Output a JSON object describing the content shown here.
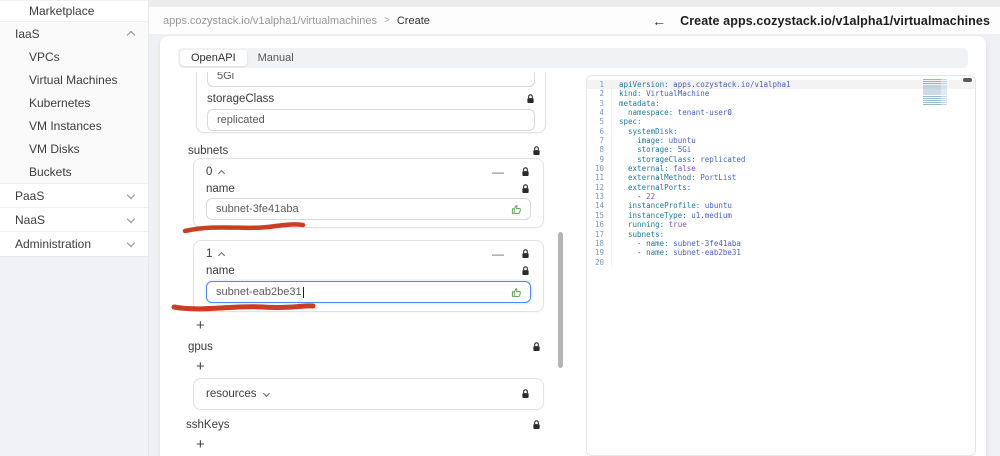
{
  "sidebar": {
    "items": [
      {
        "label": "Marketplace",
        "kind": "child",
        "divider": true,
        "group_bg": false
      },
      {
        "label": "IaaS",
        "kind": "group",
        "chevron": "up",
        "divider": true,
        "group_bg": true
      },
      {
        "label": "VPCs",
        "kind": "child",
        "divider": false,
        "group_bg": true
      },
      {
        "label": "Virtual Machines",
        "kind": "child",
        "divider": false,
        "group_bg": true
      },
      {
        "label": "Kubernetes",
        "kind": "child",
        "divider": false,
        "group_bg": true
      },
      {
        "label": "VM Instances",
        "kind": "child",
        "divider": false,
        "group_bg": true
      },
      {
        "label": "VM Disks",
        "kind": "child",
        "divider": false,
        "group_bg": true
      },
      {
        "label": "Buckets",
        "kind": "child",
        "divider": false,
        "group_bg": true
      },
      {
        "label": "PaaS",
        "kind": "group",
        "chevron": "down",
        "divider": true,
        "group_bg": false
      },
      {
        "label": "NaaS",
        "kind": "group",
        "chevron": "down",
        "divider": true,
        "group_bg": false
      },
      {
        "label": "Administration",
        "kind": "group",
        "chevron": "down",
        "divider": true,
        "group_bg": false
      }
    ]
  },
  "breadcrumb": {
    "path": "apps.cozystack.io/v1alpha1/virtualmachines",
    "current": "Create"
  },
  "header": {
    "title": "Create apps.cozystack.io/v1alpha1/virtualmachines"
  },
  "tabs": [
    {
      "label": "OpenAPI",
      "active": true
    },
    {
      "label": "Manual",
      "active": false
    }
  ],
  "icons": {
    "back_arrow": "←",
    "breadcrumb_separator": ">",
    "add": "+",
    "remove": "—",
    "lock": "lock-icon",
    "thumb_up": "thumb-up-icon"
  },
  "form": {
    "storage": {
      "value": "5Gi"
    },
    "storage_class": {
      "label": "storageClass",
      "value": "replicated"
    },
    "subnets": {
      "label": "subnets",
      "items": [
        {
          "index": "0",
          "name_label": "name",
          "value": "subnet-3fe41aba",
          "focused": false
        },
        {
          "index": "1",
          "name_label": "name",
          "value": "subnet-eab2be31",
          "focused": true
        }
      ]
    },
    "gpus_label": "gpus",
    "resources_label": "resources",
    "sshkeys_label": "sshKeys"
  },
  "annotations": {
    "underline_1": "hand-drawn red underline below subnet-3fe41aba input",
    "underline_2": "hand-drawn red underline below subnet-eab2be31 input",
    "color": "#c93418"
  },
  "colors": {
    "focus_border": "#4c8bf5",
    "thumb_green": "#64a85c",
    "editor_key": "#1f7b97",
    "editor_value": "#4a5fc0",
    "editor_literal": "#7b51c9",
    "annotation_red": "#c93418"
  },
  "editor": {
    "active_line": "1",
    "lines": [
      {
        "n": "1",
        "t": [
          [
            "k",
            "apiVersion:"
          ],
          [
            "v",
            " apps.cozystack.io/v1alpha1"
          ]
        ]
      },
      {
        "n": "2",
        "t": [
          [
            "k",
            "kind:"
          ],
          [
            "v",
            " VirtualMachine"
          ]
        ]
      },
      {
        "n": "3",
        "t": [
          [
            "k",
            "metadata:"
          ]
        ]
      },
      {
        "n": "4",
        "t": [
          [
            "p",
            "  "
          ],
          [
            "k",
            "namespace:"
          ],
          [
            "v",
            " tenant-user0"
          ]
        ]
      },
      {
        "n": "5",
        "t": [
          [
            "k",
            "spec:"
          ]
        ]
      },
      {
        "n": "6",
        "t": [
          [
            "p",
            "  "
          ],
          [
            "k",
            "systemDisk:"
          ]
        ]
      },
      {
        "n": "7",
        "t": [
          [
            "p",
            "    "
          ],
          [
            "k",
            "image:"
          ],
          [
            "v",
            " ubuntu"
          ]
        ]
      },
      {
        "n": "8",
        "t": [
          [
            "p",
            "    "
          ],
          [
            "k",
            "storage:"
          ],
          [
            "v",
            " 5Gi"
          ]
        ]
      },
      {
        "n": "9",
        "t": [
          [
            "p",
            "    "
          ],
          [
            "k",
            "storageClass:"
          ],
          [
            "v",
            " replicated"
          ]
        ]
      },
      {
        "n": "10",
        "t": [
          [
            "p",
            "  "
          ],
          [
            "k",
            "external:"
          ],
          [
            "b",
            " false"
          ]
        ]
      },
      {
        "n": "11",
        "t": [
          [
            "p",
            "  "
          ],
          [
            "k",
            "externalMethod:"
          ],
          [
            "v",
            " PortList"
          ]
        ]
      },
      {
        "n": "12",
        "t": [
          [
            "p",
            "  "
          ],
          [
            "k",
            "externalPorts:"
          ]
        ]
      },
      {
        "n": "13",
        "t": [
          [
            "p",
            "    - "
          ],
          [
            "b",
            "22"
          ]
        ]
      },
      {
        "n": "14",
        "t": [
          [
            "p",
            "  "
          ],
          [
            "k",
            "instanceProfile:"
          ],
          [
            "v",
            " ubuntu"
          ]
        ]
      },
      {
        "n": "15",
        "t": [
          [
            "p",
            "  "
          ],
          [
            "k",
            "instanceType:"
          ],
          [
            "v",
            " u1.medium"
          ]
        ]
      },
      {
        "n": "16",
        "t": [
          [
            "p",
            "  "
          ],
          [
            "k",
            "running:"
          ],
          [
            "b",
            " true"
          ]
        ]
      },
      {
        "n": "17",
        "t": [
          [
            "p",
            "  "
          ],
          [
            "k",
            "subnets:"
          ]
        ]
      },
      {
        "n": "18",
        "t": [
          [
            "p",
            "    - "
          ],
          [
            "k",
            "name:"
          ],
          [
            "v",
            " subnet-3fe41aba"
          ]
        ]
      },
      {
        "n": "19",
        "t": [
          [
            "p",
            "    - "
          ],
          [
            "k",
            "name:"
          ],
          [
            "v",
            " subnet-eab2be31"
          ]
        ]
      },
      {
        "n": "20",
        "t": []
      }
    ]
  }
}
